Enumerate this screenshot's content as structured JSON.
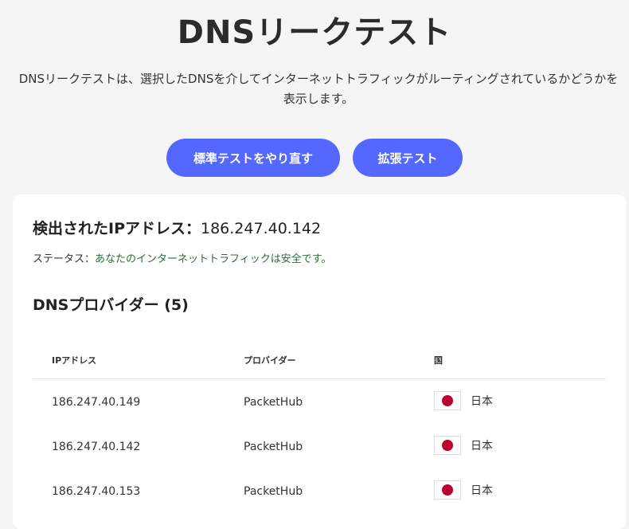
{
  "page": {
    "title": "DNSリークテスト",
    "description": "DNSリークテストは、選択したDNSを介してインターネットトラフィックがルーティングされているかどうかを表示します。"
  },
  "buttons": {
    "standard": "標準テストをやり直す",
    "extended": "拡張テスト"
  },
  "result": {
    "ip_label": "検出されたIPアドレス：",
    "ip_value": "186.247.40.142",
    "status_label": "ステータス：",
    "status_value": "あなたのインターネットトラフィックは安全です。"
  },
  "providers": {
    "heading": "DNSプロバイダー (5)",
    "columns": [
      "IPアドレス",
      "プロバイダー",
      "国"
    ],
    "rows": [
      {
        "ip": "186.247.40.149",
        "provider": "PacketHub",
        "country": "日本",
        "flag": "japan-flag-icon"
      },
      {
        "ip": "186.247.40.142",
        "provider": "PacketHub",
        "country": "日本",
        "flag": "japan-flag-icon"
      },
      {
        "ip": "186.247.40.153",
        "provider": "PacketHub",
        "country": "日本",
        "flag": "japan-flag-icon"
      }
    ]
  },
  "colors": {
    "accent": "#5468ff",
    "status_ok": "#2e6b3a"
  }
}
